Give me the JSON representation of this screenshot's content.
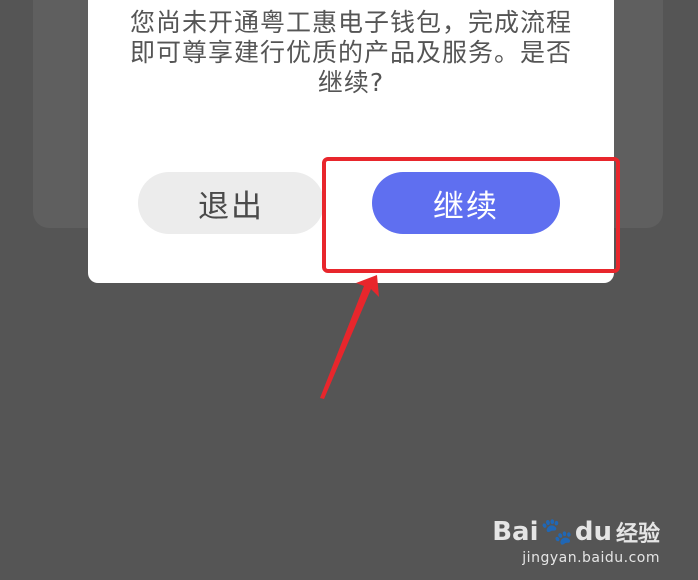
{
  "dialog": {
    "message": "您尚未开通粤工惠电子钱包，完成流程即可尊享建行优质的产品及服务。是否继续?",
    "exit_label": "退出",
    "continue_label": "继续"
  },
  "annotation": {
    "highlight_color": "#e8262c"
  },
  "watermark": {
    "brand_left": "Bai",
    "brand_right": "du",
    "brand_cn": "经验",
    "url": "jingyan.baidu.com"
  }
}
